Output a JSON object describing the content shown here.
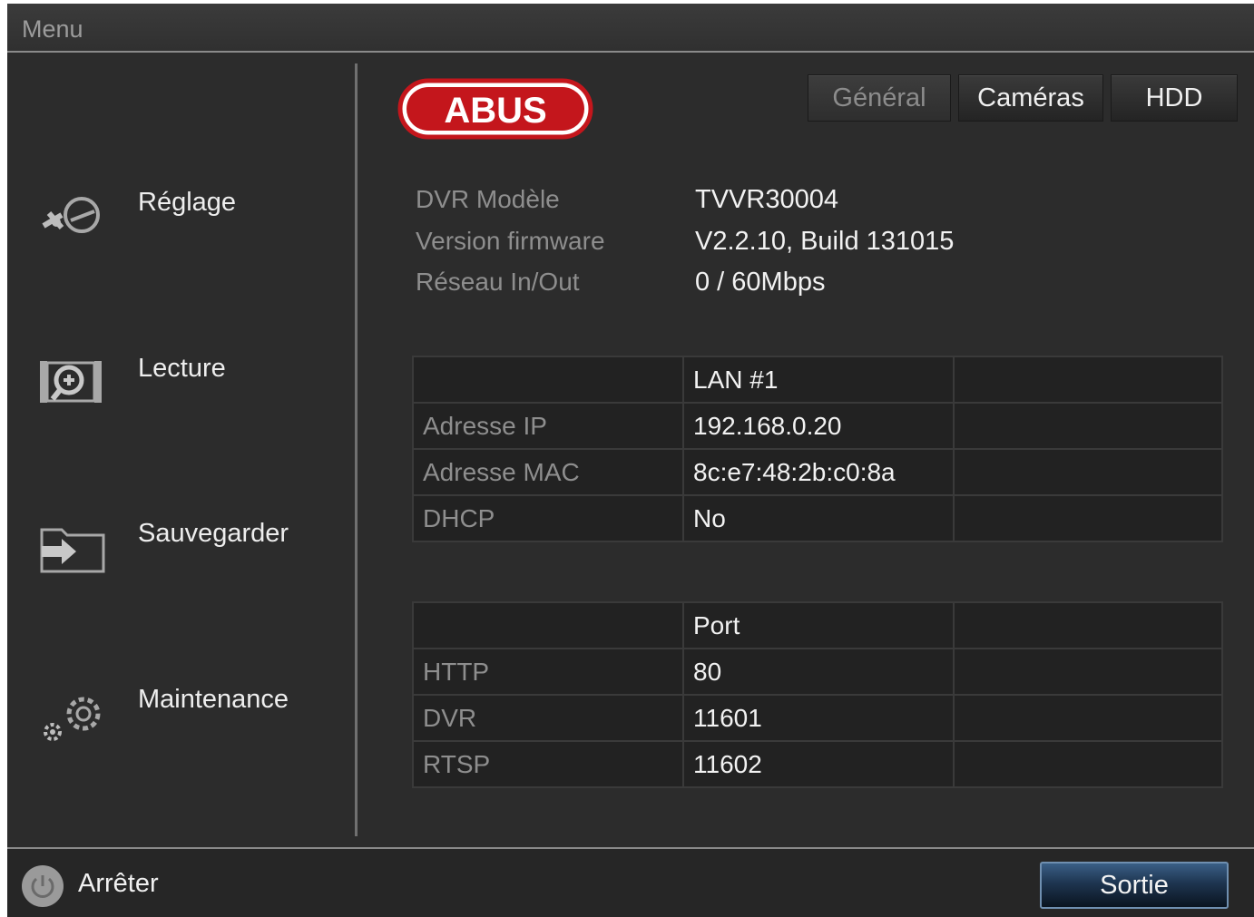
{
  "window": {
    "title": "Menu"
  },
  "sidebar": {
    "items": [
      {
        "label": "Réglage",
        "icon": "settings-tools-icon"
      },
      {
        "label": "Lecture",
        "icon": "playback-film-icon"
      },
      {
        "label": "Sauvegarder",
        "icon": "backup-export-icon"
      },
      {
        "label": "Maintenance",
        "icon": "maintenance-gears-icon"
      }
    ]
  },
  "header": {
    "logo_text": "ABUS",
    "tabs": [
      {
        "label": "Général",
        "state": "inactive"
      },
      {
        "label": "Caméras",
        "state": "active"
      },
      {
        "label": "HDD",
        "state": "active"
      }
    ]
  },
  "device_info": [
    {
      "key": "DVR Modèle",
      "value": "TVVR30004"
    },
    {
      "key": "Version firmware",
      "value": "V2.2.10, Build 131015"
    },
    {
      "key": "Réseau In/Out",
      "value": "0 / 60Mbps"
    }
  ],
  "network_table": {
    "header": [
      "",
      "LAN #1",
      ""
    ],
    "rows": [
      [
        "Adresse IP",
        "192.168.0.20",
        ""
      ],
      [
        "Adresse MAC",
        "8c:e7:48:2b:c0:8a",
        ""
      ],
      [
        "DHCP",
        "No",
        ""
      ]
    ]
  },
  "port_table": {
    "header": [
      "",
      "Port",
      ""
    ],
    "rows": [
      [
        "HTTP",
        "80",
        ""
      ],
      [
        "DVR",
        "11601",
        ""
      ],
      [
        "RTSP",
        "11602",
        ""
      ]
    ]
  },
  "footer": {
    "shutdown_label": "Arrêter",
    "exit_label": "Sortie"
  },
  "colors": {
    "background": "#2c2c2c",
    "logo_red": "#c4161c",
    "exit_button": "#1e3550"
  }
}
